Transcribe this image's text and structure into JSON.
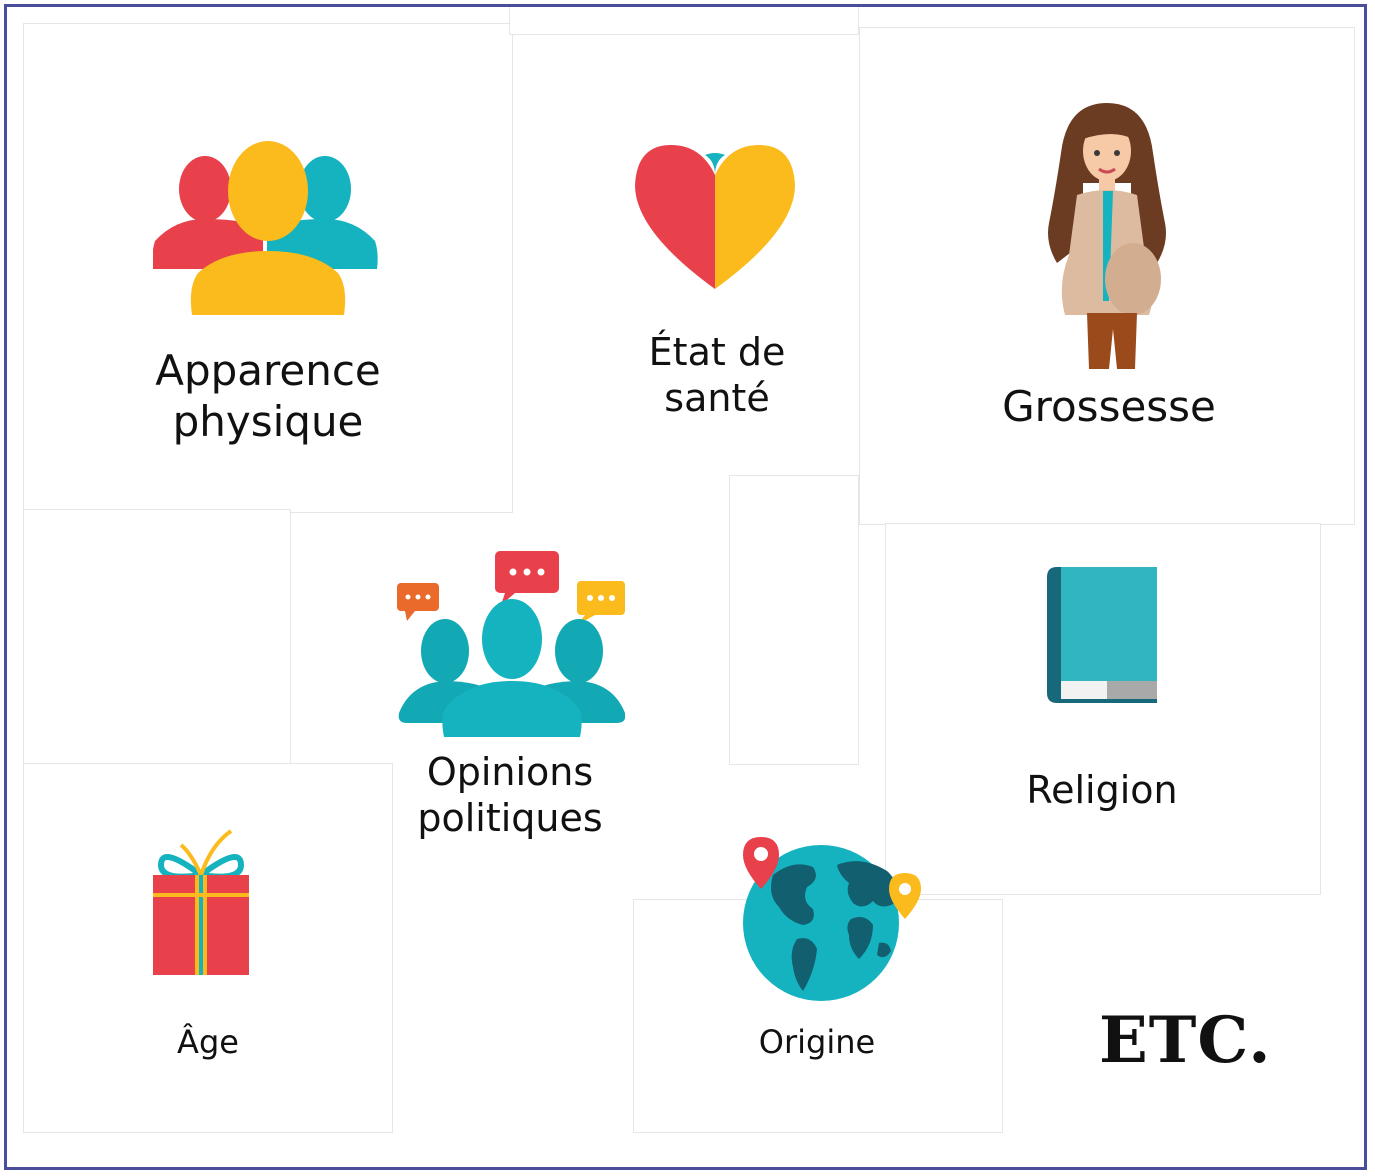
{
  "categories": {
    "physical": {
      "label": "Apparence physique",
      "icon": "people-group-icon"
    },
    "health": {
      "label": "État de santé",
      "icon": "heart-icon"
    },
    "pregnancy": {
      "label": "Grossesse",
      "icon": "pregnant-woman-icon"
    },
    "political": {
      "label": "Opinions politiques",
      "icon": "speech-bubbles-people-icon"
    },
    "religion": {
      "label": "Religion",
      "icon": "book-icon"
    },
    "age": {
      "label": "Âge",
      "icon": "gift-icon"
    },
    "origin": {
      "label": "Origine",
      "icon": "globe-pins-icon"
    }
  },
  "etc_label": "ETC.",
  "colors": {
    "red": "#e8414c",
    "yellow": "#fbbb1c",
    "teal": "#14b3bf",
    "frame": "#4a4d99"
  }
}
